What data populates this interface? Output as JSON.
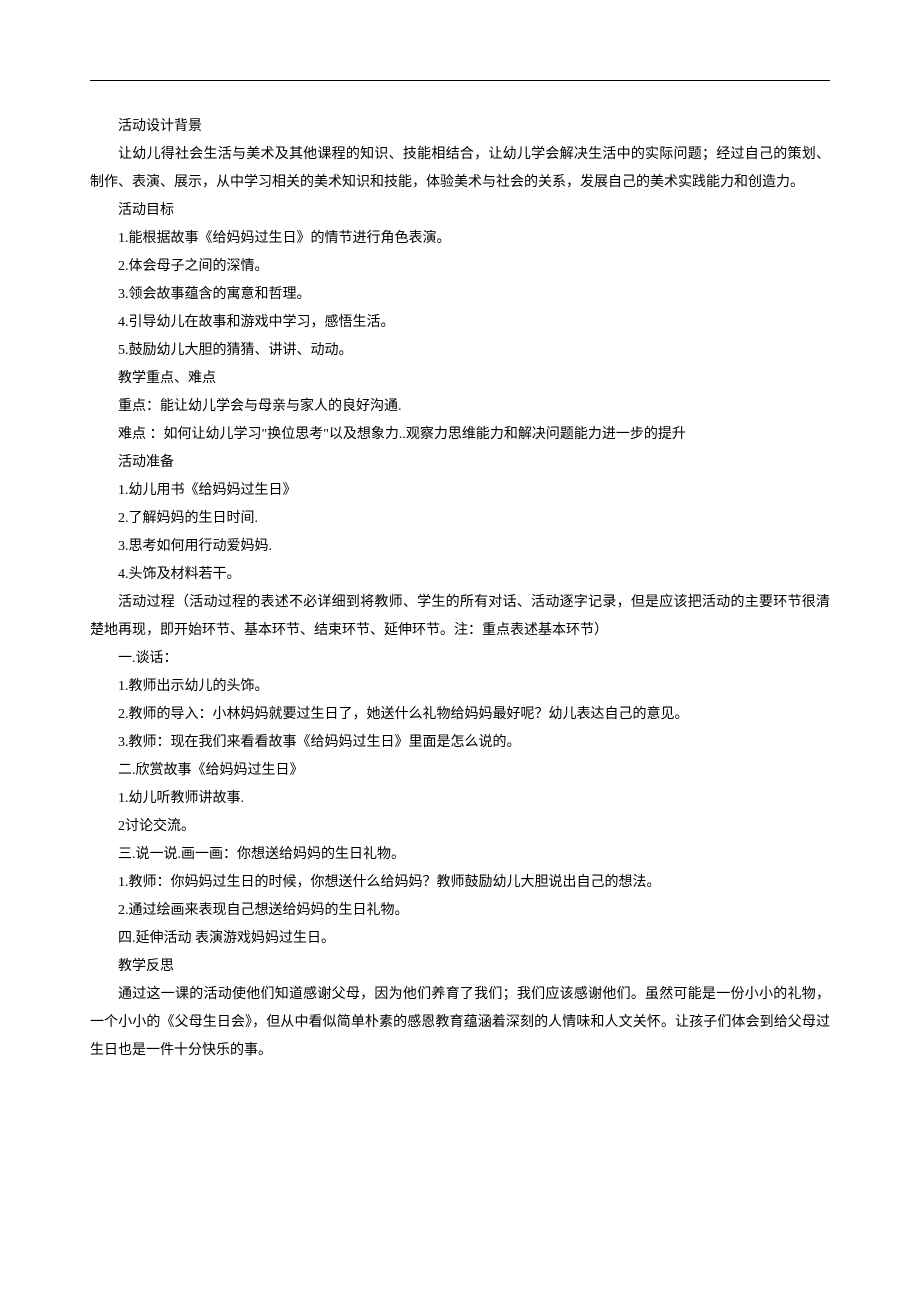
{
  "paragraphs": [
    "活动设计背景",
    "让幼儿得社会生活与美术及其他课程的知识、技能相结合，让幼儿学会解决生活中的实际问题；经过自己的策划、制作、表演、展示，从中学习相关的美术知识和技能，体验美术与社会的关系，发展自己的美术实践能力和创造力。",
    "活动目标",
    "1.能根据故事《给妈妈过生日》的情节进行角色表演。",
    "2.体会母子之间的深情。",
    "3.领会故事蕴含的寓意和哲理。",
    "4.引导幼儿在故事和游戏中学习，感悟生活。",
    "5.鼓励幼儿大胆的猜猜、讲讲、动动。",
    "教学重点、难点",
    "重点：能让幼儿学会与母亲与家人的良好沟通.",
    "难点 ：如何让幼儿学习\"换位思考\"以及想象力..观察力思维能力和解决问题能力进一步的提升",
    "活动准备",
    "1.幼儿用书《给妈妈过生日》",
    "2.了解妈妈的生日时间.",
    "3.思考如何用行动爱妈妈.",
    "4.头饰及材料若干。",
    "活动过程（活动过程的表述不必详细到将教师、学生的所有对话、活动逐字记录，但是应该把活动的主要环节很清楚地再现，即开始环节、基本环节、结束环节、延伸环节。注：重点表述基本环节）",
    "一.谈话：",
    "1.教师出示幼儿的头饰。",
    "2.教师的导入：小林妈妈就要过生日了，她送什么礼物给妈妈最好呢？幼儿表达自己的意见。",
    "3.教师：现在我们来看看故事《给妈妈过生日》里面是怎么说的。",
    "二.欣赏故事《给妈妈过生日》",
    "1.幼儿听教师讲故事.",
    "2讨论交流。",
    "三.说一说.画一画：你想送给妈妈的生日礼物。",
    "1.教师：你妈妈过生日的时候，你想送什么给妈妈？教师鼓励幼儿大胆说出自己的想法。",
    "2.通过绘画来表现自己想送给妈妈的生日礼物。",
    "四.延伸活动  表演游戏妈妈过生日。",
    "教学反思",
    "通过这一课的活动使他们知道感谢父母，因为他们养育了我们；我们应该感谢他们。虽然可能是一份小小的礼物，一个小小的《父母生日会》，但从中看似简单朴素的感恩教育蕴涵着深刻的人情味和人文关怀。让孩子们体会到给父母过生日也是一件十分快乐的事。"
  ]
}
